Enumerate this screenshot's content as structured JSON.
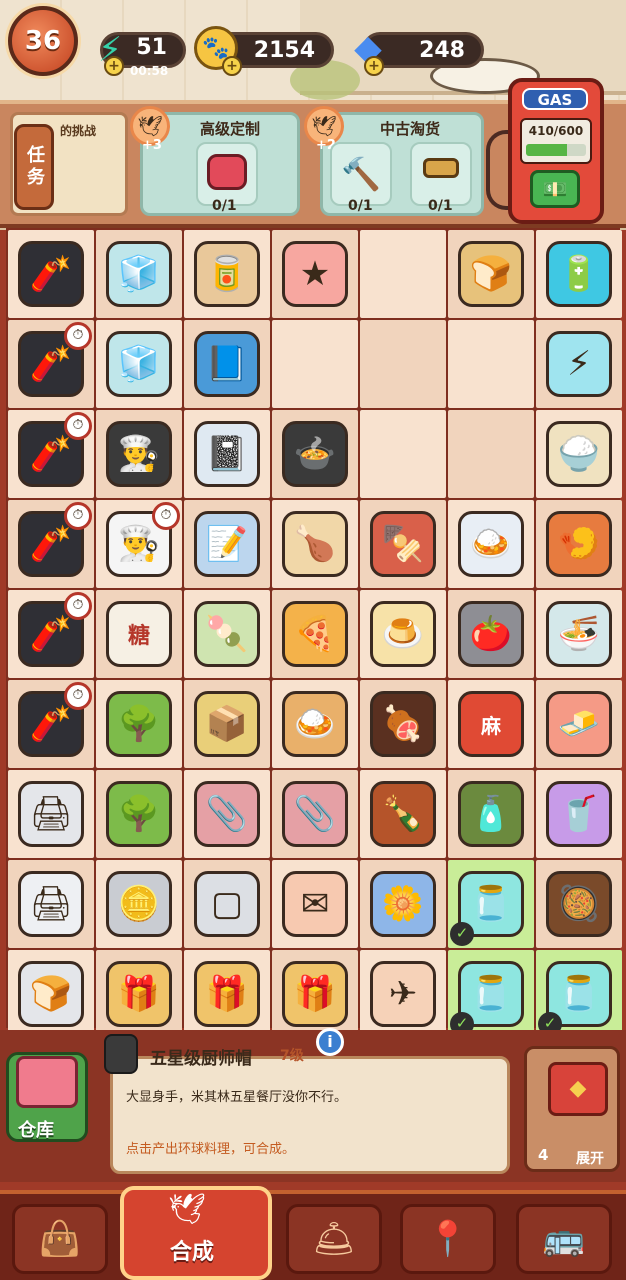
{
  "header": {
    "level": "36",
    "energy": {
      "value": "51",
      "timer": "00:58",
      "icon": "lightning-icon"
    },
    "coins": {
      "value": "2154",
      "icon": "paw-coin-icon"
    },
    "gems": {
      "value": "248",
      "icon": "diamond-icon"
    }
  },
  "orders": {
    "task_button": "任务",
    "task_label": "的挑战",
    "panels": [
      {
        "title": "高级定制",
        "bonus": "+3",
        "slots": [
          {
            "icon": "hot-water-bag-icon",
            "count": "0/1"
          }
        ]
      },
      {
        "title": "中古淘货",
        "bonus": "+2",
        "slots": [
          {
            "icon": "hammer-icon",
            "count": "0/1"
          },
          {
            "icon": "mallet-icon",
            "count": "0/1"
          }
        ]
      }
    ]
  },
  "gas": {
    "sign": "GAS",
    "meter": "410/600",
    "fill_fraction": 0.68
  },
  "board": {
    "rows": [
      [
        "firecracker",
        "fridge",
        "shelf",
        "star",
        "empty",
        "toast",
        "battery"
      ],
      [
        "firecracker-timer",
        "fridge-open",
        "notebook-blue",
        "empty",
        "empty",
        "empty",
        "battery-disc"
      ],
      [
        "firecracker-timer",
        "chef-hat-black",
        "notebook-spiral",
        "soup-pot",
        "empty",
        "empty",
        "rice-block"
      ],
      [
        "firecracker-timer",
        "chef-hat-white-timer",
        "notepad",
        "roast-chicken",
        "skewers",
        "chicken-rice",
        "shrimp-bowl"
      ],
      [
        "firecracker-timer",
        "sugar-jar",
        "skewer-basket",
        "pizza",
        "pudding-tray",
        "pot-tomato",
        "noodle-bowl"
      ],
      [
        "firecracker-timer",
        "bonsai",
        "drone-box",
        "curry-plate",
        "grill-board",
        "chili-jar",
        "tofu"
      ],
      [
        "printer-old",
        "bonsai",
        "clip",
        "clip",
        "sauce-bottle",
        "ketchup-bottle",
        "purple-drink"
      ],
      [
        "printer",
        "silver-bars",
        "metal-plates",
        "envelope",
        "flower-card",
        "jar-selected",
        "stew-bowl"
      ],
      [
        "toaster",
        "sticker-pack",
        "gift-box",
        "gift-box",
        "paper-plane",
        "jar-selected",
        "jar-selected"
      ]
    ],
    "sugar_label": "糖",
    "chili_label": "麻"
  },
  "info": {
    "title": "五星级厨师帽",
    "level": "7级",
    "description": "大显身手，米其林五星餐厅没你不行。",
    "tip": "点击产出环球料理，可合成。",
    "info_button": "i"
  },
  "warehouse": {
    "label": "仓库"
  },
  "chest": {
    "count": "4",
    "label": "展开"
  },
  "nav": {
    "active_label": "合成",
    "items": [
      "shop-bag-icon",
      "merge-icon",
      "cloche-icon",
      "map-icon",
      "bus-icon"
    ]
  }
}
